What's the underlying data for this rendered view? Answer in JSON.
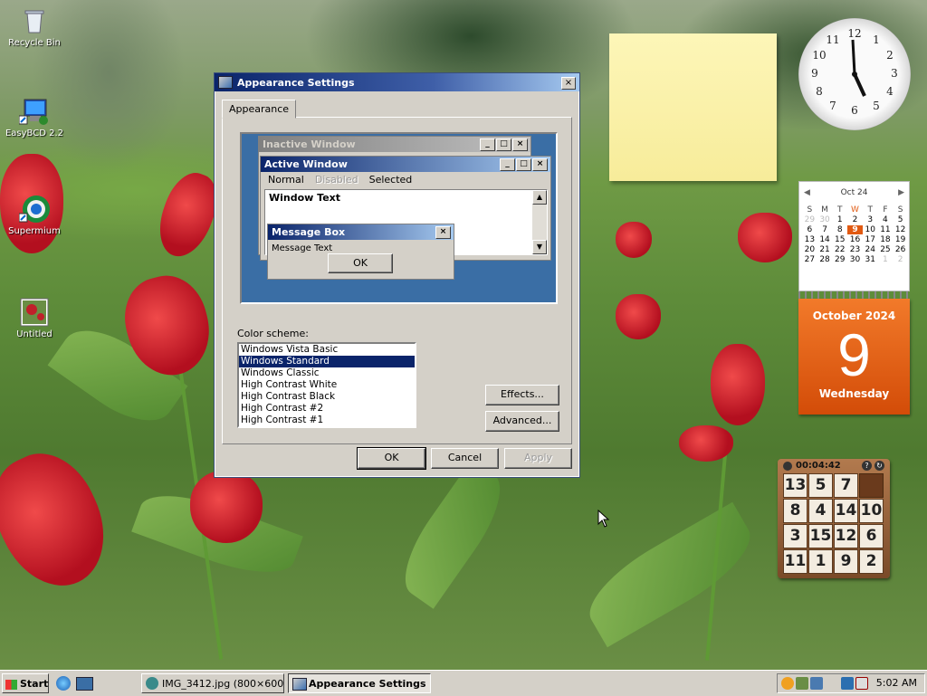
{
  "desktop": {
    "icons": [
      {
        "label": "Recycle Bin"
      },
      {
        "label": "EasyBCD 2.2"
      },
      {
        "label": "Supermium"
      },
      {
        "label": "Untitled"
      }
    ]
  },
  "window": {
    "title": "Appearance Settings",
    "close_label": "×",
    "tab_label": "Appearance",
    "preview": {
      "inactive_title": "Inactive Window",
      "active_title": "Active Window",
      "menu_normal": "Normal",
      "menu_disabled": "Disabled",
      "menu_selected": "Selected",
      "window_text": "Window Text",
      "msgbox_title": "Message Box",
      "msgbox_text": "Message Text",
      "msgbox_ok": "OK"
    },
    "color_scheme_label": "Color scheme:",
    "color_schemes": [
      "Windows Vista Basic",
      "Windows Standard",
      "Windows Classic",
      "High Contrast White",
      "High Contrast Black",
      "High Contrast #2",
      "High Contrast #1"
    ],
    "selected_scheme": "Windows Standard",
    "effects_button": "Effects...",
    "advanced_button": "Advanced...",
    "ok_button": "OK",
    "cancel_button": "Cancel",
    "apply_button": "Apply"
  },
  "gadgets": {
    "clock": {
      "numbers": [
        "12",
        "1",
        "2",
        "3",
        "4",
        "5",
        "6",
        "7",
        "8",
        "9",
        "10",
        "11"
      ]
    },
    "calendar": {
      "month_title": "Oct 24",
      "dow": [
        "S",
        "M",
        "T",
        "W",
        "T",
        "F",
        "S"
      ],
      "days": [
        [
          "29",
          "30",
          "1",
          "2",
          "3",
          "4",
          "5"
        ],
        [
          "6",
          "7",
          "8",
          "9",
          "10",
          "11",
          "12"
        ],
        [
          "13",
          "14",
          "15",
          "16",
          "17",
          "18",
          "19"
        ],
        [
          "20",
          "21",
          "22",
          "23",
          "24",
          "25",
          "26"
        ],
        [
          "27",
          "28",
          "29",
          "30",
          "31",
          "1",
          "2"
        ]
      ],
      "month_year": "October 2024",
      "day_number": "9",
      "weekday": "Wednesday"
    },
    "puzzle": {
      "timer": "00:04:42",
      "tiles": [
        "13",
        "5",
        "7",
        "",
        "8",
        "4",
        "14",
        "10",
        "3",
        "15",
        "12",
        "6",
        "11",
        "1",
        "9",
        "2"
      ]
    }
  },
  "taskbar": {
    "start_label": "Start",
    "items": [
      {
        "label": "IMG_3412.jpg (800×600..."
      },
      {
        "label": "Appearance Settings"
      }
    ],
    "time": "5:02 AM"
  },
  "colors": {
    "title_active": "#0a246a",
    "preview_desktop": "#3a6ea5",
    "calendar_orange": "#e15a12"
  }
}
